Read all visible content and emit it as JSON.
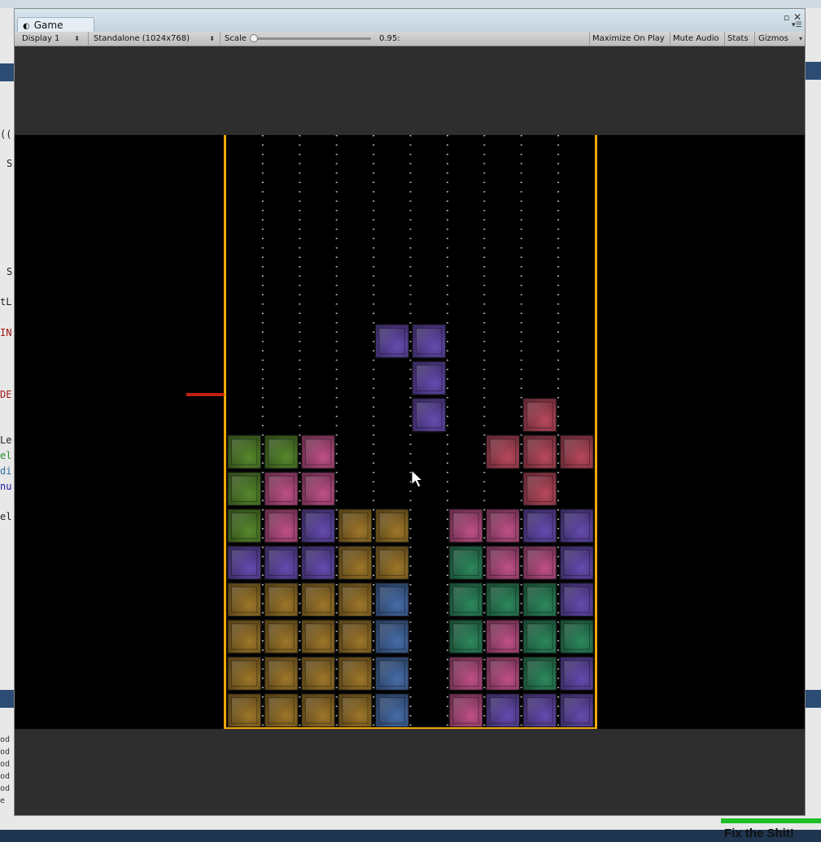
{
  "window": {
    "tab_title": "Game",
    "tab_icon": "game-icon"
  },
  "toolbar": {
    "display": "Display 1",
    "resolution": "Standalone (1024x768)",
    "scale_label": "Scale",
    "scale_value": "0.95:",
    "scale_fraction": 0.0,
    "maximize": "Maximize On Play",
    "mute": "Mute Audio",
    "stats": "Stats",
    "gizmos": "Gizmos"
  },
  "background": {
    "code_chars": [
      "((",
      "S",
      "S",
      "tL",
      "IN",
      "DE",
      "Le",
      "el",
      "di",
      "nu",
      "el"
    ],
    "console_lines": [
      "od",
      "od",
      "od",
      "od",
      "od",
      "e"
    ],
    "banner_text": "Fix the Shit!"
  },
  "board": {
    "columns": 10,
    "rows": 16,
    "colors": {
      "G": "#5b8f2f",
      "P": "#c9558f",
      "V": "#6a4fb8",
      "O": "#a57d2c",
      "B": "#4a72b0",
      "T": "#2f8f62",
      "R": "#c14d62",
      "frame": "#f0a80c"
    },
    "grid": [
      "..........",
      "..........",
      "..........",
      "..........",
      "..........",
      "..........",
      "....VV....",
      ".....V....",
      ".....V..R.",
      "GGP....RRR",
      "GPP.....R.",
      "GPVOO.PPVV",
      "VVVOO.TPPV",
      "OOOOB.TTTV",
      "OOOOB.TPTT",
      "OOOOB.PPTV",
      "OOOOB.PVVV"
    ]
  }
}
